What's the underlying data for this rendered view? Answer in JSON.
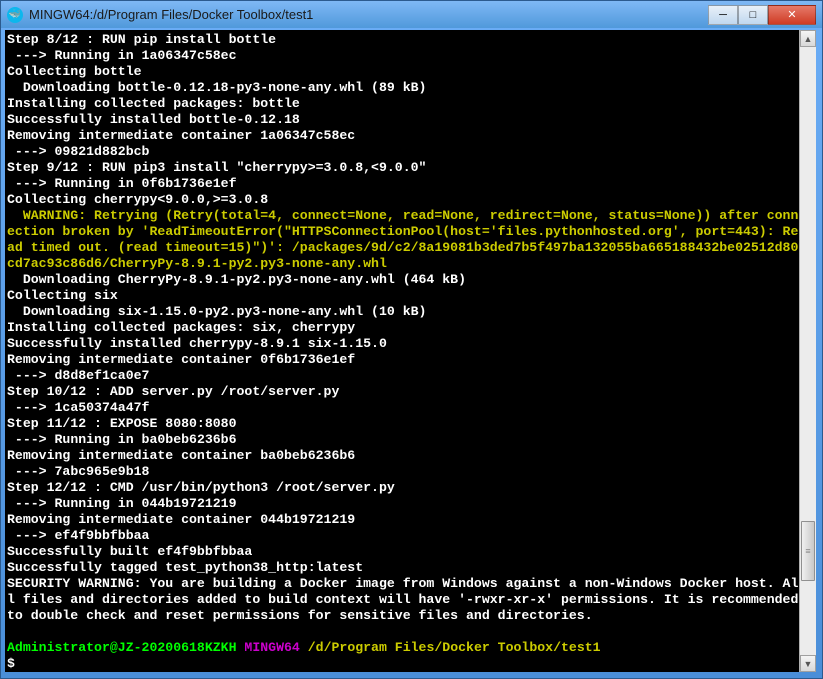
{
  "window": {
    "title": "MINGW64:/d/Program Files/Docker Toolbox/test1",
    "minimize": "─",
    "maximize": "□",
    "close": "✕"
  },
  "terminal": {
    "lines": [
      "Step 8/12 : RUN pip install bottle",
      " ---> Running in 1a06347c58ec",
      "Collecting bottle",
      "  Downloading bottle-0.12.18-py3-none-any.whl (89 kB)",
      "Installing collected packages: bottle",
      "Successfully installed bottle-0.12.18",
      "Removing intermediate container 1a06347c58ec",
      " ---> 09821d882bcb",
      "Step 9/12 : RUN pip3 install \"cherrypy>=3.0.8,<9.0.0\"",
      " ---> Running in 0f6b1736e1ef",
      "Collecting cherrypy<9.0.0,>=3.0.8"
    ],
    "warning": "  WARNING: Retrying (Retry(total=4, connect=None, read=None, redirect=None, status=None)) after connection broken by 'ReadTimeoutError(\"HTTPSConnectionPool(host='files.pythonhosted.org', port=443): Read timed out. (read timeout=15)\")': /packages/9d/c2/8a19081b3ded7b5f497ba132055ba665188432be02512d80cd7ac93c86d6/CherryPy-8.9.1-py2.py3-none-any.whl",
    "lines2": [
      "  Downloading CherryPy-8.9.1-py2.py3-none-any.whl (464 kB)",
      "Collecting six",
      "  Downloading six-1.15.0-py2.py3-none-any.whl (10 kB)",
      "Installing collected packages: six, cherrypy",
      "Successfully installed cherrypy-8.9.1 six-1.15.0",
      "Removing intermediate container 0f6b1736e1ef",
      " ---> d8d8ef1ca0e7",
      "Step 10/12 : ADD server.py /root/server.py",
      " ---> 1ca50374a47f",
      "Step 11/12 : EXPOSE 8080:8080",
      " ---> Running in ba0beb6236b6",
      "Removing intermediate container ba0beb6236b6",
      " ---> 7abc965e9b18",
      "Step 12/12 : CMD /usr/bin/python3 /root/server.py",
      " ---> Running in 044b19721219",
      "Removing intermediate container 044b19721219",
      " ---> ef4f9bbfbbaa",
      "Successfully built ef4f9bbfbbaa",
      "Successfully tagged test_python38_http:latest",
      "SECURITY WARNING: You are building a Docker image from Windows against a non-Windows Docker host. All files and directories added to build context will have '-rwxr-xr-x' permissions. It is recommended to double check and reset permissions for sensitive files and directories.",
      ""
    ],
    "prompt": {
      "user": "Administrator@JZ-20200618KZKH",
      "shell": "MINGW64",
      "path": "/d/Program Files/Docker Toolbox/test1",
      "cursor": "$"
    }
  },
  "scrollbar": {
    "up": "▲",
    "down": "▼",
    "grip": "≡"
  }
}
